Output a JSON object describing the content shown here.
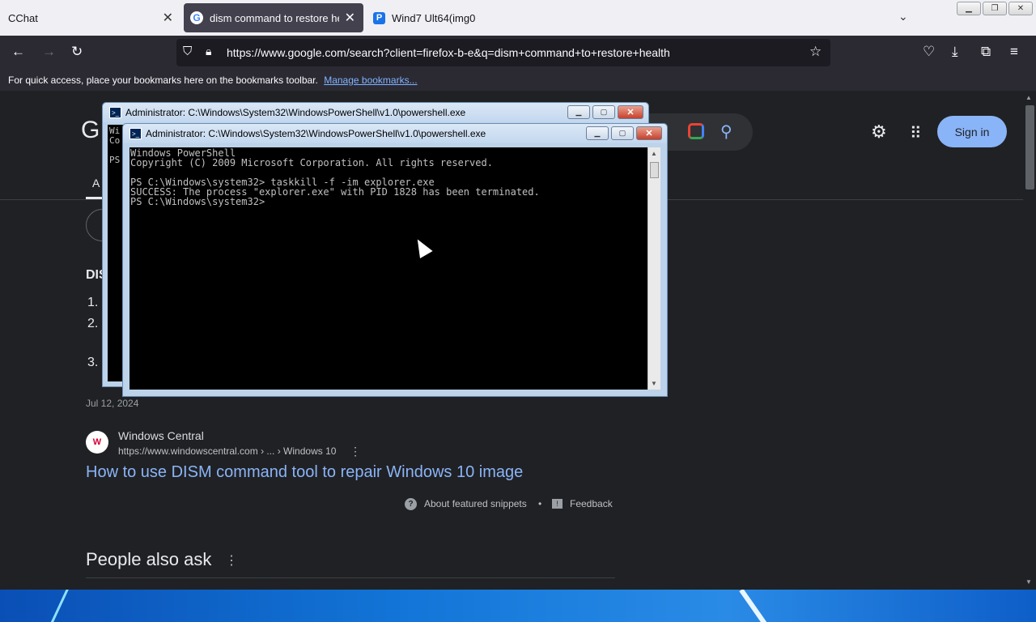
{
  "browser": {
    "tabs": [
      {
        "title": "CChat"
      },
      {
        "title": "dism command to restore health"
      },
      {
        "title": "Wind7 Ult64(img0"
      }
    ],
    "url": "https://www.google.com/search?client=firefox-b-e&q=dism+command+to+restore+health",
    "bookmarks_bar": {
      "text": "For quick access, place your bookmarks here on the bookmarks toolbar.",
      "link": "Manage bookmarks..."
    }
  },
  "google": {
    "logo_letter": "G",
    "signin_label": "Sign in",
    "tab_first_letter": "A",
    "snippet_heading_partial": "DIS",
    "snippet_list": [
      "1.",
      "2.",
      "3."
    ],
    "date": "Jul 12, 2024",
    "result": {
      "site_name": "Windows Central",
      "site_url": "https://www.windowscentral.com › ... › Windows 10",
      "title": "How to use DISM command tool to repair Windows 10 image"
    },
    "about_snippets": "About featured snippets",
    "dot": "•",
    "feedback": "Feedback",
    "people_also_ask": "People also ask"
  },
  "powershell_back": {
    "title": "Administrator: C:\\Windows\\System32\\WindowsPowerShell\\v1.0\\powershell.exe",
    "peek": [
      "Wi",
      "Co",
      "",
      "PS"
    ]
  },
  "powershell_front": {
    "title": "Administrator: C:\\Windows\\System32\\WindowsPowerShell\\v1.0\\powershell.exe",
    "lines": [
      "Windows PowerShell",
      "Copyright (C) 2009 Microsoft Corporation. All rights reserved.",
      "",
      "PS C:\\Windows\\system32> taskkill -f -im explorer.exe",
      "SUCCESS: The process \"explorer.exe\" with PID 1828 has been terminated.",
      "PS C:\\Windows\\system32>"
    ]
  },
  "colors": {
    "page_bg": "#202124",
    "link": "#8ab4f8",
    "console_bg": "#000000",
    "console_text": "#c0c0c0"
  }
}
